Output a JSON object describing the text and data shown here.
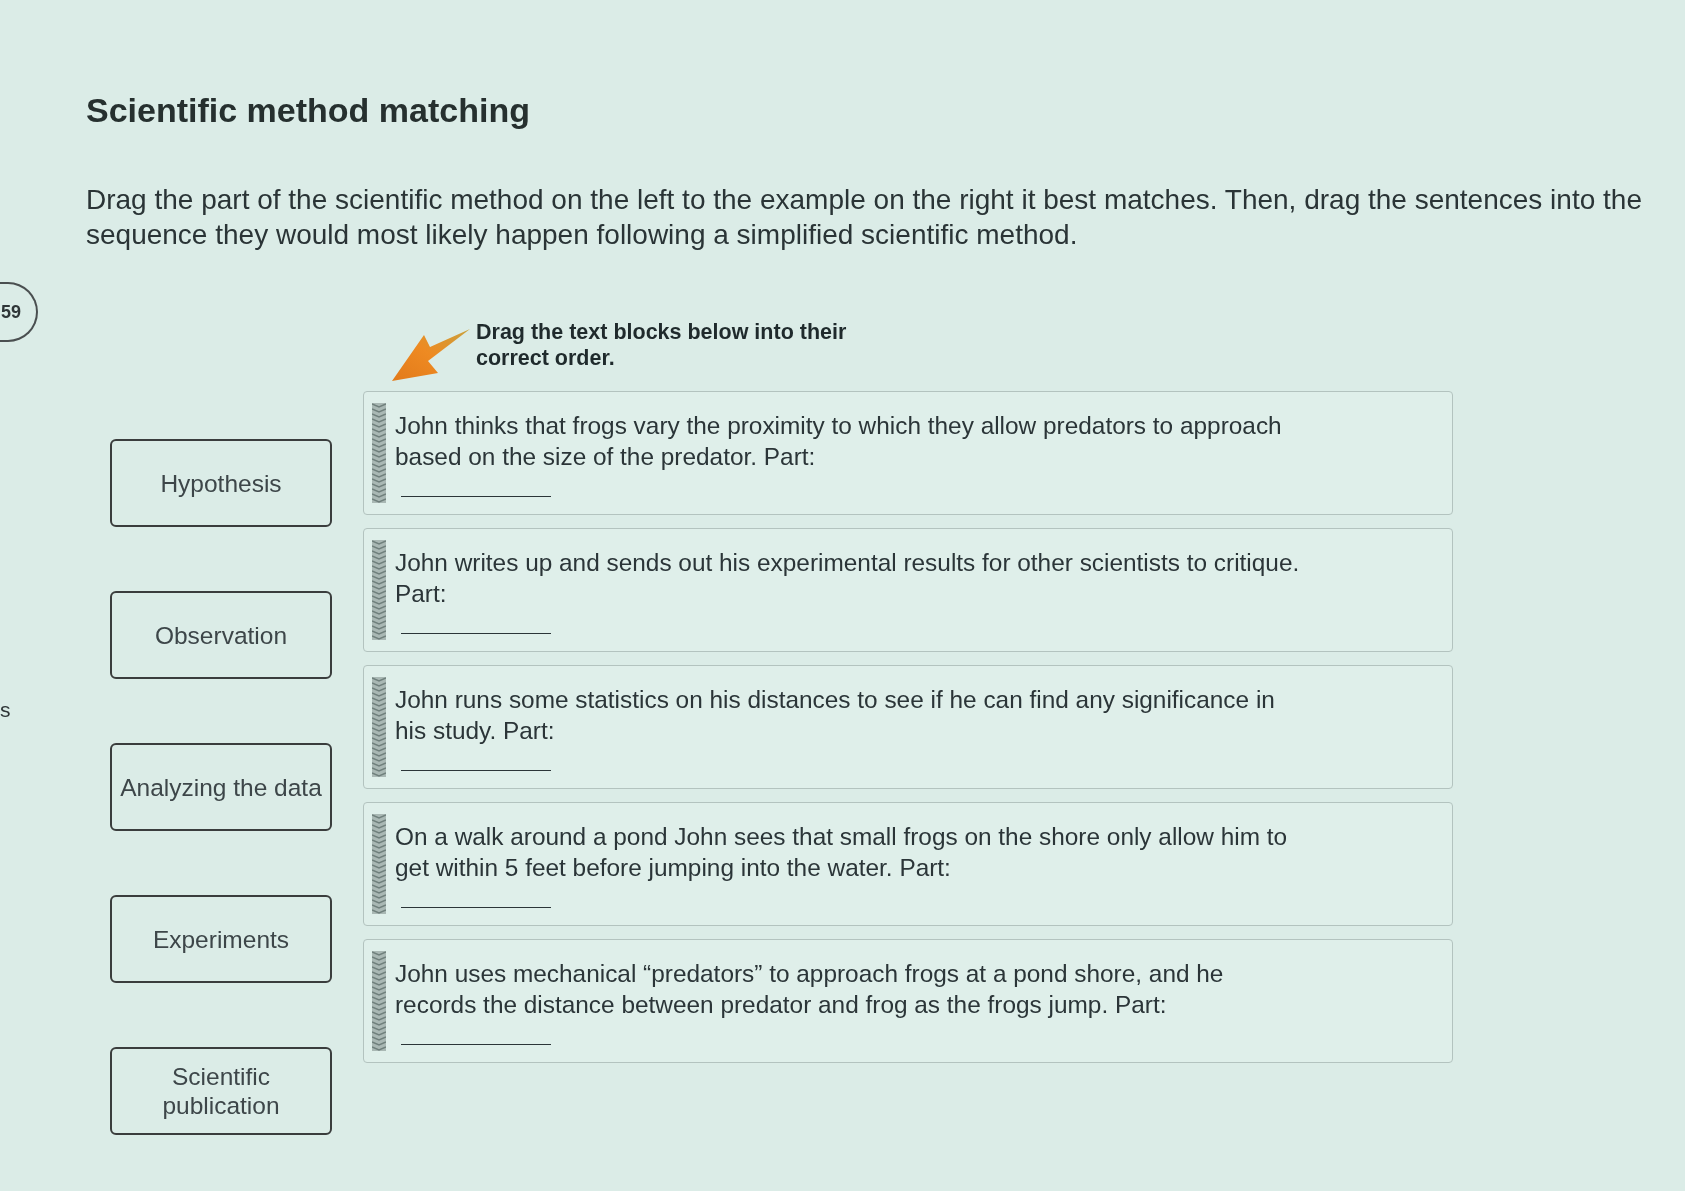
{
  "edge": {
    "badge": "59",
    "letter": "s"
  },
  "title": "Scientific method matching",
  "instructions": "Drag the part of the scientific method on the left to the example on the right it best matches. Then, drag the sentences into the sequence they would most likely happen following a simplified scientific method.",
  "parts": [
    "Hypothesis",
    "Observation",
    "Analyzing the data",
    "Experiments",
    "Scientific publication"
  ],
  "order_prompt": "Drag the text blocks below into their correct order.",
  "sentences": [
    "John thinks that frogs vary the proximity to which they allow predators to approach based on the size of the predator. Part:",
    "John writes up and sends out his experimental results for other scientists to critique. Part:",
    "John runs some statistics on his distances to see if he can find any significance in his study. Part:",
    "On a walk around a pond John sees that small frogs on the shore only allow him to get within 5 feet before jumping into the water. Part:",
    "John uses mechanical “predators” to approach frogs at a pond shore, and he records the distance between predator and frog as the frogs jump. Part:"
  ]
}
